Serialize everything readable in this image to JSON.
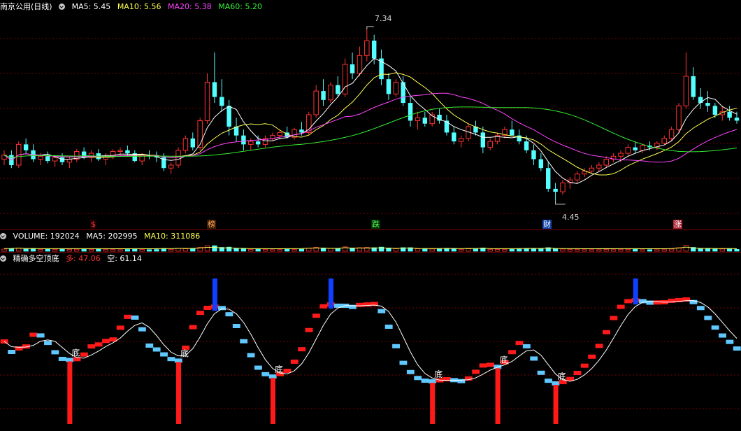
{
  "main": {
    "title": "南京公用(日线)",
    "ma": [
      {
        "label": "MA5: 5.45",
        "color": "#ffffff"
      },
      {
        "label": "MA10: 5.56",
        "color": "#ffff55"
      },
      {
        "label": "MA20: 5.38",
        "color": "#ff44ff"
      },
      {
        "label": "MA60: 5.20",
        "color": "#33ee33"
      }
    ],
    "high_label": "7.34",
    "low_label": "4.45",
    "events": [
      {
        "text": "$",
        "color": "#ff3333",
        "bg": "#200000"
      },
      {
        "text": "榜",
        "color": "#ffaa66",
        "bg": "#3a1a00"
      },
      {
        "text": "跌",
        "color": "#66ff66",
        "bg": "#003300"
      },
      {
        "text": "财",
        "color": "#ffffff",
        "bg": "#1144aa"
      },
      {
        "text": "涨",
        "color": "#ffffff",
        "bg": "#aa2233"
      }
    ]
  },
  "volume": {
    "label": "VOLUME: 192024",
    "ma5": "MA5: 202995",
    "ma10": "MA10: 311086"
  },
  "indicator": {
    "name": "精确多空顶底",
    "duo_label": "多: 47.06",
    "kong_label": "空: 61.14",
    "bottom_mark": "底"
  },
  "colors": {
    "up": "#ff3232",
    "down": "#54ffff",
    "ind_up": "#ff1a1a",
    "ind_down": "#5fc8ff",
    "grid": "#7a0000"
  },
  "chart_data": {
    "type": "candlestick",
    "price_axis": [
      4.2,
      7.6
    ],
    "candles_ohlc": [
      [
        5.15,
        5.3,
        5.05,
        5.22
      ],
      [
        5.22,
        5.3,
        5.0,
        5.05
      ],
      [
        5.05,
        5.45,
        5.0,
        5.4
      ],
      [
        5.4,
        5.5,
        5.25,
        5.3
      ],
      [
        5.3,
        5.4,
        5.1,
        5.15
      ],
      [
        5.15,
        5.25,
        5.05,
        5.2
      ],
      [
        5.2,
        5.28,
        5.08,
        5.12
      ],
      [
        5.12,
        5.22,
        5.02,
        5.18
      ],
      [
        5.18,
        5.25,
        5.05,
        5.1
      ],
      [
        5.1,
        5.2,
        5.0,
        5.15
      ],
      [
        5.15,
        5.32,
        5.1,
        5.28
      ],
      [
        5.28,
        5.35,
        5.15,
        5.18
      ],
      [
        5.18,
        5.3,
        5.1,
        5.25
      ],
      [
        5.25,
        5.32,
        5.12,
        5.15
      ],
      [
        5.15,
        5.25,
        5.05,
        5.2
      ],
      [
        5.2,
        5.32,
        5.15,
        5.28
      ],
      [
        5.28,
        5.35,
        5.2,
        5.3
      ],
      [
        5.3,
        5.38,
        5.2,
        5.25
      ],
      [
        5.25,
        5.3,
        5.1,
        5.12
      ],
      [
        5.12,
        5.25,
        5.05,
        5.22
      ],
      [
        5.22,
        5.3,
        5.15,
        5.2
      ],
      [
        5.2,
        5.28,
        5.1,
        5.18
      ],
      [
        5.18,
        5.25,
        4.95,
        5.0
      ],
      [
        5.0,
        5.1,
        4.9,
        5.05
      ],
      [
        5.05,
        5.35,
        5.0,
        5.3
      ],
      [
        5.3,
        5.55,
        5.25,
        5.5
      ],
      [
        5.5,
        5.6,
        5.3,
        5.35
      ],
      [
        5.35,
        5.85,
        5.3,
        5.8
      ],
      [
        5.8,
        6.6,
        5.75,
        6.45
      ],
      [
        6.45,
        6.95,
        6.1,
        6.2
      ],
      [
        6.2,
        6.5,
        5.95,
        6.05
      ],
      [
        6.05,
        6.15,
        5.55,
        5.7
      ],
      [
        5.7,
        5.85,
        5.45,
        5.55
      ],
      [
        5.55,
        5.65,
        5.3,
        5.4
      ],
      [
        5.4,
        5.5,
        5.3,
        5.45
      ],
      [
        5.45,
        5.55,
        5.35,
        5.4
      ],
      [
        5.4,
        5.55,
        5.35,
        5.5
      ],
      [
        5.5,
        5.6,
        5.45,
        5.55
      ],
      [
        5.55,
        5.65,
        5.48,
        5.6
      ],
      [
        5.6,
        5.7,
        5.5,
        5.52
      ],
      [
        5.52,
        5.68,
        5.48,
        5.65
      ],
      [
        5.65,
        5.78,
        5.55,
        5.6
      ],
      [
        5.6,
        5.95,
        5.55,
        5.9
      ],
      [
        5.9,
        6.4,
        5.85,
        6.3
      ],
      [
        6.3,
        6.5,
        6.05,
        6.15
      ],
      [
        6.15,
        6.45,
        6.1,
        6.4
      ],
      [
        6.4,
        6.55,
        6.2,
        6.25
      ],
      [
        6.25,
        6.85,
        6.2,
        6.75
      ],
      [
        6.75,
        6.95,
        6.5,
        6.6
      ],
      [
        6.6,
        7.05,
        6.55,
        6.9
      ],
      [
        6.9,
        7.34,
        6.8,
        7.15
      ],
      [
        7.15,
        7.25,
        6.75,
        6.85
      ],
      [
        6.85,
        7.0,
        6.4,
        6.5
      ],
      [
        6.5,
        6.6,
        6.15,
        6.25
      ],
      [
        6.25,
        6.5,
        6.2,
        6.45
      ],
      [
        6.45,
        6.55,
        6.05,
        6.1
      ],
      [
        6.1,
        6.2,
        5.7,
        5.8
      ],
      [
        5.8,
        5.95,
        5.65,
        5.85
      ],
      [
        5.85,
        5.95,
        5.7,
        5.75
      ],
      [
        5.75,
        5.95,
        5.7,
        5.9
      ],
      [
        5.9,
        6.0,
        5.75,
        5.8
      ],
      [
        5.8,
        5.9,
        5.55,
        5.6
      ],
      [
        5.6,
        5.7,
        5.4,
        5.45
      ],
      [
        5.45,
        5.55,
        5.35,
        5.5
      ],
      [
        5.5,
        5.75,
        5.45,
        5.7
      ],
      [
        5.7,
        5.8,
        5.55,
        5.6
      ],
      [
        5.6,
        5.7,
        5.25,
        5.35
      ],
      [
        5.35,
        5.5,
        5.3,
        5.45
      ],
      [
        5.45,
        5.6,
        5.4,
        5.55
      ],
      [
        5.55,
        5.7,
        5.5,
        5.65
      ],
      [
        5.65,
        5.8,
        5.6,
        5.55
      ],
      [
        5.55,
        5.65,
        5.4,
        5.45
      ],
      [
        5.45,
        5.55,
        5.25,
        5.3
      ],
      [
        5.3,
        5.4,
        5.05,
        5.15
      ],
      [
        5.15,
        5.25,
        4.95,
        5.0
      ],
      [
        5.0,
        5.1,
        4.6,
        4.65
      ],
      [
        4.65,
        4.75,
        4.45,
        4.6
      ],
      [
        4.6,
        4.8,
        4.55,
        4.75
      ],
      [
        4.75,
        4.85,
        4.65,
        4.8
      ],
      [
        4.8,
        4.95,
        4.75,
        4.9
      ],
      [
        4.9,
        5.0,
        4.85,
        4.95
      ],
      [
        4.95,
        5.05,
        4.9,
        5.0
      ],
      [
        5.0,
        5.1,
        4.95,
        5.05
      ],
      [
        5.05,
        5.2,
        5.0,
        5.15
      ],
      [
        5.15,
        5.25,
        5.1,
        5.2
      ],
      [
        5.2,
        5.3,
        5.1,
        5.25
      ],
      [
        5.25,
        5.4,
        5.2,
        5.35
      ],
      [
        5.35,
        5.45,
        5.25,
        5.3
      ],
      [
        5.3,
        5.4,
        5.25,
        5.38
      ],
      [
        5.38,
        5.45,
        5.3,
        5.35
      ],
      [
        5.35,
        5.45,
        5.3,
        5.42
      ],
      [
        5.42,
        5.55,
        5.4,
        5.5
      ],
      [
        5.5,
        5.7,
        5.45,
        5.65
      ],
      [
        5.65,
        6.1,
        5.6,
        6.05
      ],
      [
        6.05,
        6.95,
        6.0,
        6.55
      ],
      [
        6.55,
        6.7,
        6.15,
        6.2
      ],
      [
        6.2,
        6.35,
        6.0,
        6.1
      ],
      [
        6.1,
        6.3,
        5.95,
        6.05
      ],
      [
        6.05,
        6.1,
        5.85,
        5.9
      ],
      [
        5.9,
        6.05,
        5.8,
        5.95
      ],
      [
        5.95,
        6.05,
        5.8,
        5.85
      ],
      [
        5.85,
        5.95,
        5.75,
        5.8
      ]
    ]
  }
}
